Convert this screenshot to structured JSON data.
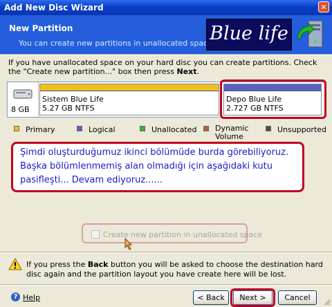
{
  "window": {
    "title": "Add New Disc Wizard",
    "close_glyph": "✕"
  },
  "header": {
    "title": "New Partition",
    "subtitle": "You can create new partitions in unallocated space.",
    "logo_text": "Blue life",
    "icon": "computer-install-icon"
  },
  "instruction": {
    "before": "If you have unallocated space on your hard disc you can create partitions. Check the \"Create new partition...\" box then press ",
    "bold": "Next",
    "after": "."
  },
  "disk": {
    "icon": "hard-disk-icon",
    "size": "8 GB"
  },
  "partitions": [
    {
      "name": "Sistem Blue Life",
      "info": "5.27 GB  NTFS",
      "color": "#f0c020"
    },
    {
      "name": "Depo Blue Life",
      "info": "2.727 GB  NTFS",
      "color": "#5861c4"
    }
  ],
  "legend": [
    {
      "label": "Primary",
      "color": "#f0c020"
    },
    {
      "label": "Logical",
      "color": "#5861c4"
    },
    {
      "label": "Unallocated",
      "color": "#3cb43c"
    },
    {
      "label_line1": "Dynamic",
      "label_line2": "Volume",
      "color": "#b06040"
    },
    {
      "label": "Unsupported",
      "color": "#505050"
    }
  ],
  "note": {
    "line1": "Şimdi oluşturduğumuz ikinci bölümüde burda görebiliyoruz.",
    "line2": "Başka bölümlenmemiş alan olmadığı için aşağıdaki kutu",
    "line3": "pasifleşti... Devam ediyoruz......"
  },
  "checkbox": {
    "label": "Create new partition in unallocated space",
    "checked": false,
    "enabled": false
  },
  "warning": {
    "part1": "If you press the ",
    "bold": "Back",
    "part2": " button you will be asked to choose the destination hard disc again and the partition layout you have create here will be lost."
  },
  "footer": {
    "help": "Help",
    "back": "< Back",
    "next": "Next >",
    "cancel": "Cancel"
  },
  "colors": {
    "accent_red": "#c00021",
    "header_blue": "#245edc",
    "note_text": "#1a1ad0"
  }
}
